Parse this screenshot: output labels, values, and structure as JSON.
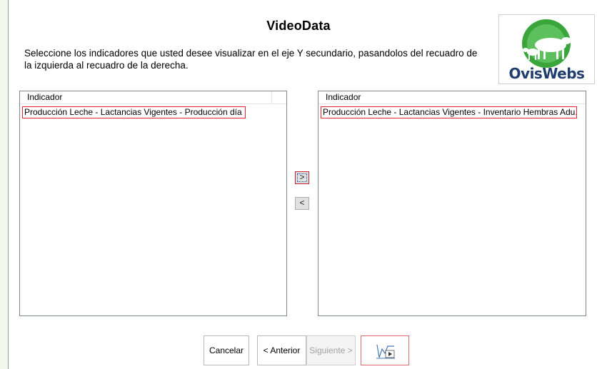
{
  "dialog": {
    "title": "VideoData",
    "instructions": "Seleccione los indicadores que usted desee visualizar en el eje Y secundario, pasandolos del recuadro de la izquierda al recuadro de la derecha."
  },
  "logo": {
    "text": "OvisWebs",
    "colors": {
      "green": "#3aa53a",
      "navy": "#1f3d6e"
    }
  },
  "left_list": {
    "column_header": "Indicador",
    "items": [
      "Producción Leche - Lactancias Vigentes - Producción día"
    ]
  },
  "right_list": {
    "column_header": "Indicador",
    "items": [
      "Producción Leche - Lactancias Vigentes - Inventario Hembras Adu..."
    ]
  },
  "move_buttons": {
    "add": ">",
    "remove": "<"
  },
  "footer": {
    "cancel": "Cancelar",
    "back": "< Anterior",
    "next": "Siguiente >",
    "video_icon": "chart-play-icon"
  },
  "colors": {
    "highlight_border": "#e8262e",
    "focus_border": "#c8232c"
  }
}
